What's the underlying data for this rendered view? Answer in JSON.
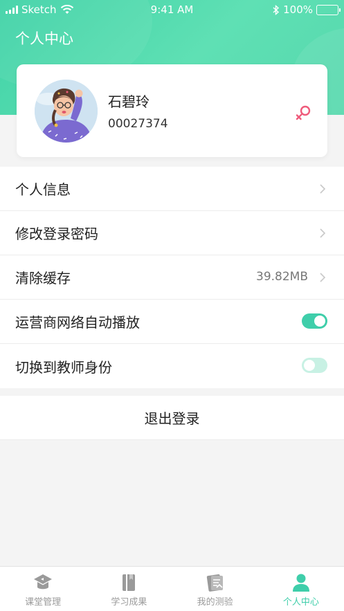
{
  "status_bar": {
    "carrier": "Sketch",
    "time": "9:41 AM",
    "battery": "100%"
  },
  "header": {
    "title": "个人中心"
  },
  "profile": {
    "name": "石碧玲",
    "id": "00027374",
    "gender_icon": "female-icon"
  },
  "menu": [
    {
      "label": "个人信息",
      "type": "link"
    },
    {
      "label": "修改登录密码",
      "type": "link"
    },
    {
      "label": "清除缓存",
      "type": "link",
      "value": "39.82MB"
    },
    {
      "label": "运营商网络自动播放",
      "type": "toggle",
      "on": true
    },
    {
      "label": "切换到教师身份",
      "type": "toggle",
      "on": false
    }
  ],
  "logout": {
    "label": "退出登录"
  },
  "tabs": [
    {
      "label": "课堂管理",
      "icon": "classroom-icon",
      "active": false
    },
    {
      "label": "学习成果",
      "icon": "book-icon",
      "active": false
    },
    {
      "label": "我的测验",
      "icon": "quiz-icon",
      "active": false
    },
    {
      "label": "个人中心",
      "icon": "person-icon",
      "active": true
    }
  ],
  "colors": {
    "accent": "#3fceaa",
    "gender": "#ef5b7b",
    "toggle_off": "#c8f1e4"
  }
}
